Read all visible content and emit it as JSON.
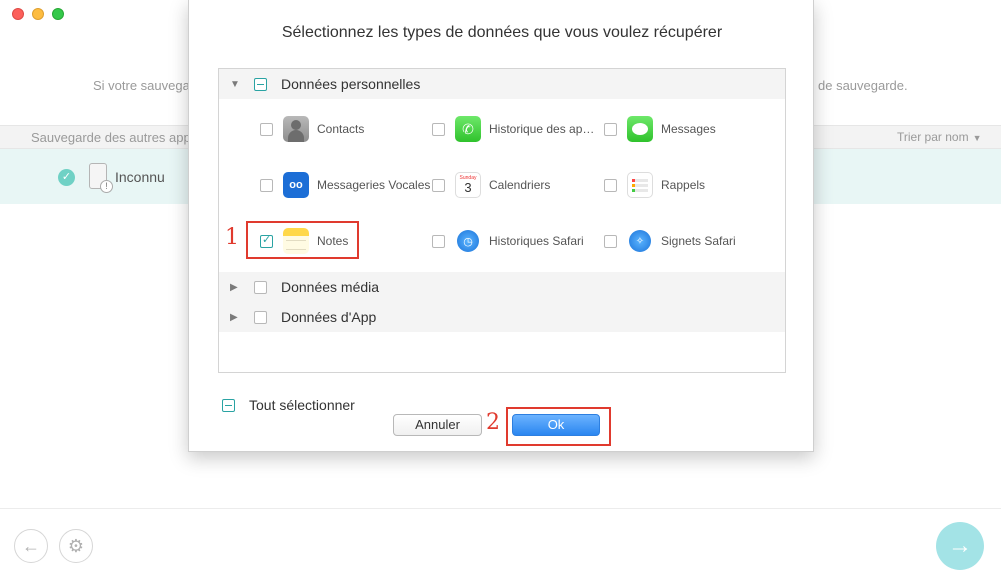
{
  "background": {
    "hint_left": "Si votre sauvega",
    "hint_right": "de sauvegarde.",
    "header_left": "Sauvegarde des autres app",
    "sort_label": "Trier par nom",
    "device_name": "Inconnu",
    "warn_glyph": "!"
  },
  "dialog": {
    "title": "Sélectionnez les types de données que vous voulez récupérer",
    "categories": {
      "personal": "Données personnelles",
      "media": "Données média",
      "app": "Données d'App"
    },
    "items": {
      "contacts": "Contacts",
      "call_history": "Historique des ap…",
      "messages": "Messages",
      "voicemail": "Messageries Vocales",
      "calendars": "Calendriers",
      "reminders": "Rappels",
      "notes": "Notes",
      "safari_history": "Historiques Safari",
      "safari_bookmarks": "Signets Safari"
    },
    "calendar_icon": {
      "month": "Sunday",
      "day": "3"
    },
    "select_all": "Tout sélectionner",
    "cancel": "Annuler",
    "ok": "Ok"
  },
  "annotations": {
    "step1": "1",
    "step2": "2"
  },
  "icons": {
    "back": "←",
    "settings": "⚙",
    "next": "→",
    "expanded": "▼",
    "collapsed": "▶",
    "phone": "✆",
    "voicemail": "oo",
    "clock": "◷",
    "compass": "✧"
  }
}
